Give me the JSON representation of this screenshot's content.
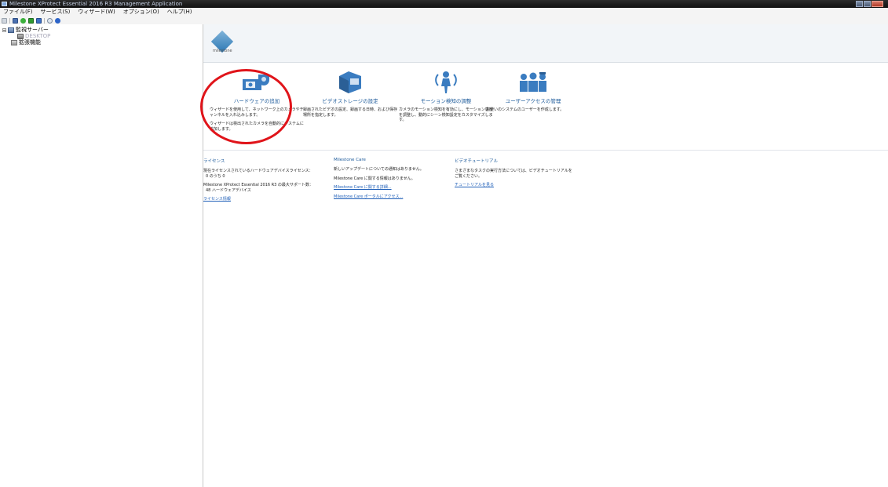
{
  "window": {
    "title": "Milestone XProtect Essential 2016 R3 Management Application"
  },
  "menubar": {
    "items": [
      {
        "label": "ファイル(F)"
      },
      {
        "label": "サービス(S)"
      },
      {
        "label": "ウィザード(W)"
      },
      {
        "label": "オプション(O)"
      },
      {
        "label": "ヘルプ(H)"
      }
    ]
  },
  "tree": {
    "root": {
      "label": "監視サーバー"
    },
    "child": {
      "label": "DESKTOP"
    },
    "child2": {
      "label": "拡張機能"
    }
  },
  "banner": {
    "logo_text": "milestone"
  },
  "tasks": [
    {
      "title": "ハードウェアの追加",
      "desc": "ウィザードを使用して、ネットワーク上のカメラやチャンネルを入れ込みします。",
      "desc2": "ウィザードは検出されたカメラを自動的にシステムに追加します。"
    },
    {
      "title": "ビデオストレージの設定",
      "desc": "録画されたビデオの設定、録画する日時、および保存場所を指定します。"
    },
    {
      "title": "モーション検知の調整",
      "desc": "カメラのモーション検知を有効にし、モーション感度を調整し、動的にシーン検知設定をカスタマイズします。"
    },
    {
      "title": "ユーザーアクセスの管理",
      "desc": "お使いのシステムのユーザーを作成します。"
    }
  ],
  "license": {
    "heading": "ライセンス",
    "text1": "現在ライセンスされているハードウェアデバイスライセンス：",
    "text1_value": "0 のうち 0",
    "text2": "Milestone XProtect Essential 2016 R3 の最大サポート数：",
    "text2_value": "48 ハードウェアデバイス",
    "link": "ライセンス情報"
  },
  "care": {
    "heading": "Milestone Care",
    "text1": "新しいアップデートについての通知はありません。",
    "text2": "Milestone Care に関する情報はありません。",
    "link1": "Milestone Care に関する詳細...",
    "link2": "Milestone Care ポータルにアクセス..."
  },
  "tutorial": {
    "heading": "ビデオチュートリアル",
    "text1": "さまざまなタスクの実行方法については、ビデオチュートリアルをご覧ください。",
    "link": "チュートリアルを見る"
  },
  "colors": {
    "accent": "#1c5a9a",
    "annotation": "#e0141a"
  }
}
